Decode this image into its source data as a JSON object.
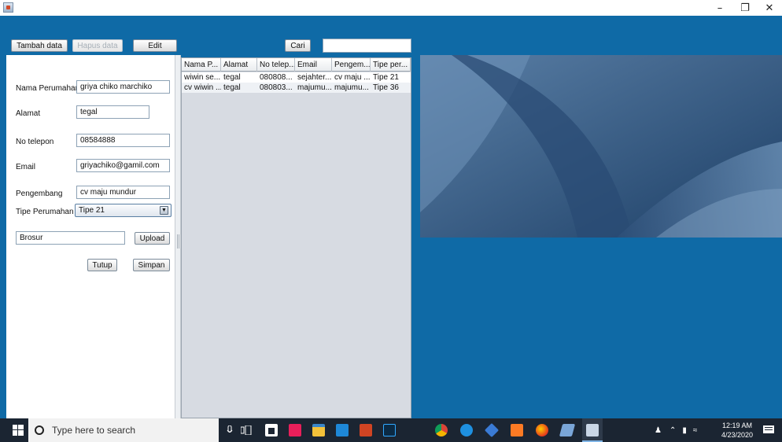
{
  "window": {
    "title": "",
    "controls": {
      "minimize": "–",
      "maximize": "❐",
      "close": "✕"
    }
  },
  "toolbar": {
    "tambah_label": "Tambah data",
    "hapus_label": "Hapus data",
    "edit_label": "Edit",
    "cari_label": "Cari",
    "search_value": ""
  },
  "form": {
    "nama_label": "Nama Perumahan",
    "nama_value": "griya chiko marchiko",
    "alamat_label": "Alamat",
    "alamat_value": "tegal",
    "telp_label": "No telepon",
    "telp_value": "08584888",
    "email_label": "Email",
    "email_value": "griyachiko@gamil.com",
    "pengembang_label": "Pengembang",
    "pengembang_value": "cv maju mundur",
    "tipe_label": "Tipe Perumahan",
    "tipe_value": "Tipe 21",
    "brosur_value": "Brosur",
    "upload_label": "Upload",
    "tutup_label": "Tutup",
    "simpan_label": "Simpan"
  },
  "table": {
    "columns": [
      "Nama P...",
      "Alamat",
      "No telep...",
      "Email",
      "Pengem...",
      "Tipe per..."
    ],
    "rows": [
      [
        "wiwin se...",
        "tegal",
        "080808...",
        "sejahter...",
        "cv maju ...",
        "Tipe 21"
      ],
      [
        "cv wiwin ...",
        "tegal",
        "080803...",
        "majumu...",
        "majumu...",
        "Tipe 36"
      ]
    ]
  },
  "taskbar": {
    "search_placeholder": "Type here to search",
    "time": "12:19 AM",
    "date": "4/23/2020"
  },
  "colors": {
    "desktop": "#0f6aa6",
    "taskbar": "#1b2532"
  }
}
